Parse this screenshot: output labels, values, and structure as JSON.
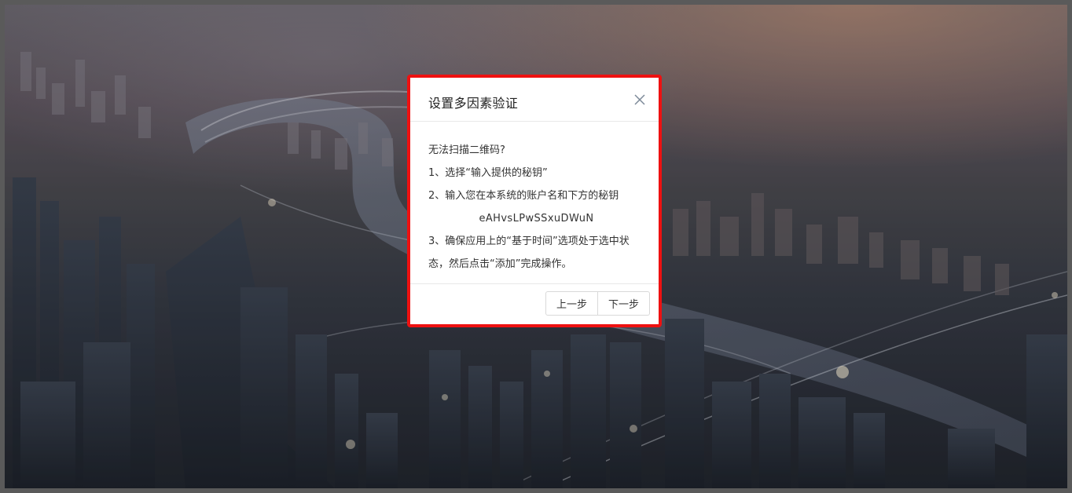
{
  "dialog": {
    "title": "设置多因素验证",
    "close_icon": "close-icon",
    "body": {
      "heading": "无法扫描二维码?",
      "step1": "1、选择“输入提供的秘钥”",
      "step2": "2、输入您在本系统的账户名和下方的秘钥",
      "secret_key": "eAHvsLPwSSxuDWuN",
      "step3": "3、确保应用上的“基于时间”选项处于选中状态，然后点击“添加”完成操作。"
    },
    "footer": {
      "prev_label": "上一步",
      "next_label": "下一步"
    }
  },
  "colors": {
    "highlight_border": "#ee1111",
    "dialog_bg": "#ffffff",
    "text": "#333333",
    "divider": "#e8e8e8"
  }
}
